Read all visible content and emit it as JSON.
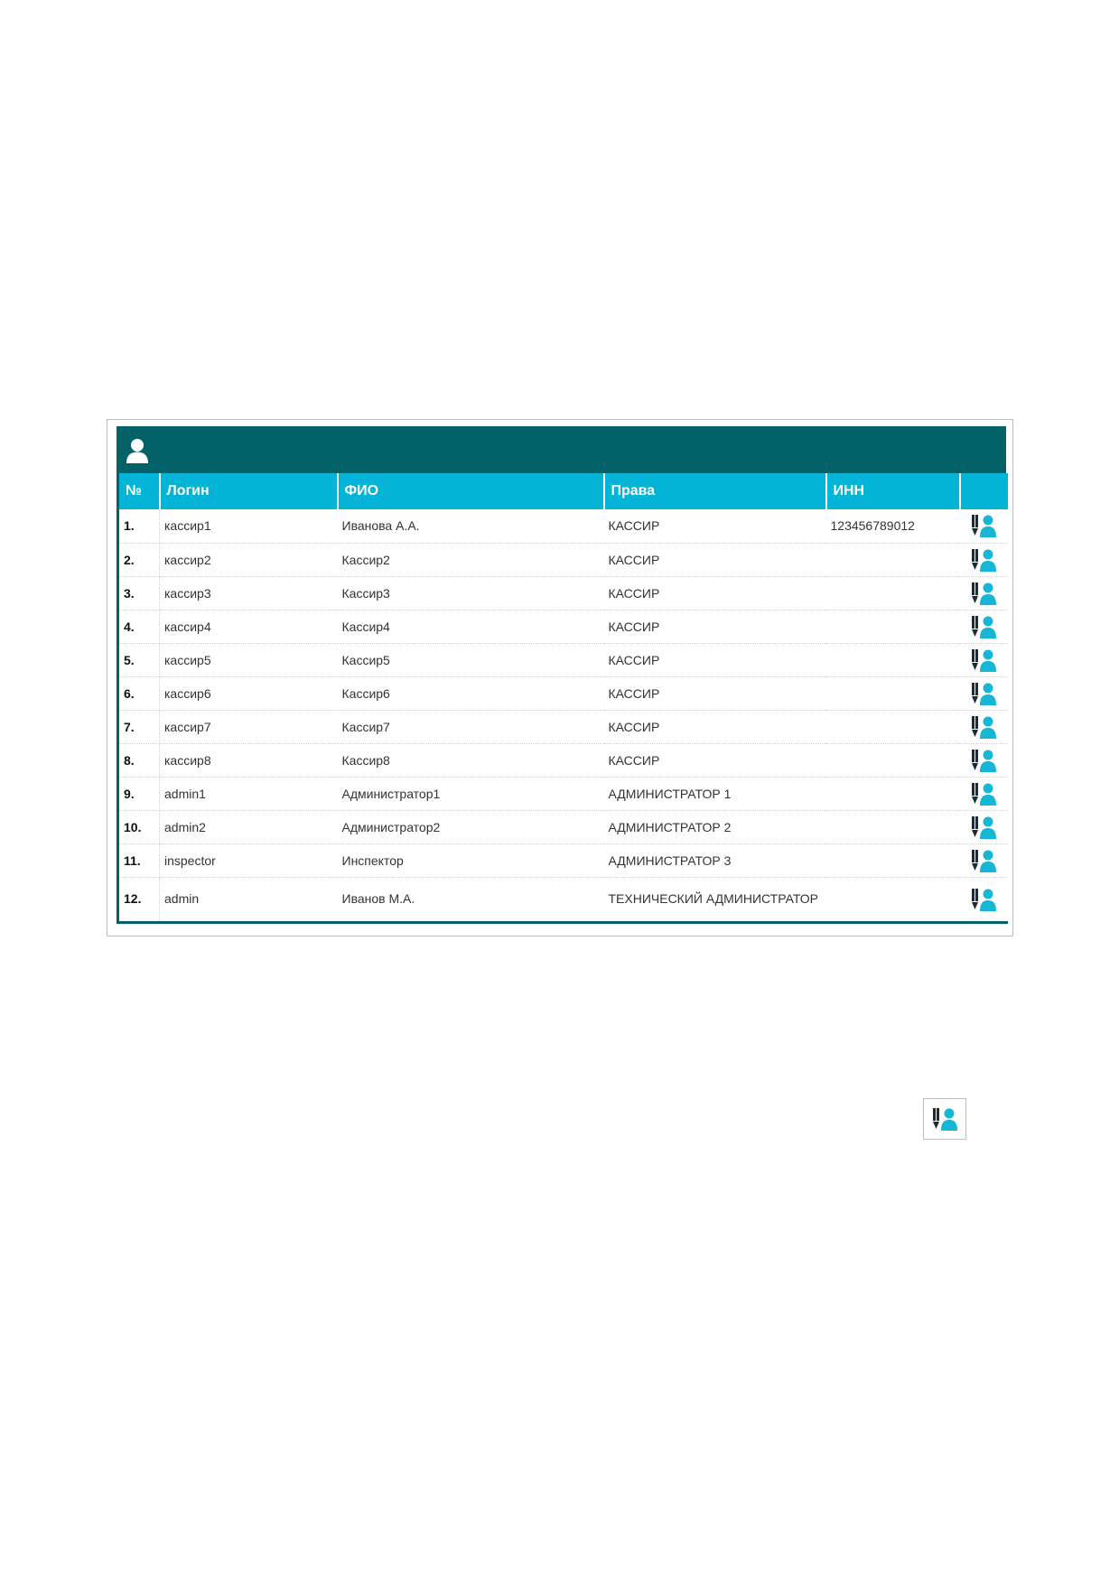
{
  "table": {
    "columns": [
      "№",
      "Логин",
      "ФИО",
      "Права",
      "ИНН",
      ""
    ],
    "rows": [
      {
        "num": "1.",
        "login": "кассир1",
        "fio": "Иванова А.А.",
        "rights": "КАССИР",
        "inn": "123456789012"
      },
      {
        "num": "2.",
        "login": "кассир2",
        "fio": "Кассир2",
        "rights": "КАССИР",
        "inn": ""
      },
      {
        "num": "3.",
        "login": "кассир3",
        "fio": "Кассир3",
        "rights": "КАССИР",
        "inn": ""
      },
      {
        "num": "4.",
        "login": "кассир4",
        "fio": "Кассир4",
        "rights": "КАССИР",
        "inn": ""
      },
      {
        "num": "5.",
        "login": "кассир5",
        "fio": "Кассир5",
        "rights": "КАССИР",
        "inn": ""
      },
      {
        "num": "6.",
        "login": "кассир6",
        "fio": "Кассир6",
        "rights": "КАССИР",
        "inn": ""
      },
      {
        "num": "7.",
        "login": "кассир7",
        "fio": "Кассир7",
        "rights": "КАССИР",
        "inn": ""
      },
      {
        "num": "8.",
        "login": "кассир8",
        "fio": "Кассир8",
        "rights": "КАССИР",
        "inn": ""
      },
      {
        "num": "9.",
        "login": "admin1",
        "fio": "Администратор1",
        "rights": "АДМИНИСТРАТОР 1",
        "inn": ""
      },
      {
        "num": "10.",
        "login": "admin2",
        "fio": "Администратор2",
        "rights": "АДМИНИСТРАТОР 2",
        "inn": ""
      },
      {
        "num": "11.",
        "login": "inspector",
        "fio": "Инспектор",
        "rights": "АДМИНИСТРАТОР 3",
        "inn": ""
      },
      {
        "num": "12.",
        "login": "admin",
        "fio": "Иванов М.А.",
        "rights": "ТЕХНИЧЕСКИЙ АДМИНИСТРАТОР",
        "inn": ""
      }
    ]
  },
  "icons": {
    "header": "user-icon",
    "row_action": "edit-user-icon",
    "standalone": "edit-user-icon"
  },
  "colors": {
    "header_bg": "#036268",
    "column_header_bg": "#03b4d6",
    "icon_dark": "#1f2a33",
    "icon_accent": "#16b6d6"
  }
}
